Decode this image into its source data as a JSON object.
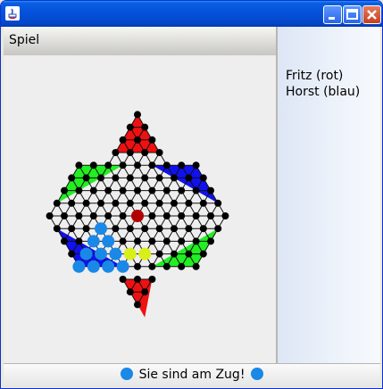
{
  "window": {
    "title": ""
  },
  "menu": {
    "items": [
      "Spiel"
    ]
  },
  "players": [
    {
      "label": "Fritz (rot)"
    },
    {
      "label": "Horst (blau)"
    }
  ],
  "status": {
    "text": "Sie sind am Zug!"
  },
  "colors": {
    "red_triangle": "#ee1111",
    "green_triangle": "#22ee22",
    "blue_triangle": "#1111ee",
    "red_piece": "#b00000",
    "blue_piece": "#1a88e6",
    "highlight": "#d8ef1a",
    "hole": "#000000",
    "board_bg": "#eeeeee"
  },
  "board": {
    "type": "star-halma",
    "red_pieces": [
      [
        0,
        4
      ],
      [
        1,
        4
      ],
      [
        1,
        5
      ],
      [
        2,
        4
      ],
      [
        2,
        5
      ],
      [
        2,
        6
      ],
      [
        3,
        4
      ],
      [
        3,
        5
      ],
      [
        3,
        6
      ],
      [
        3,
        7
      ],
      [
        8,
        6
      ]
    ],
    "blue_pieces": [
      [
        9,
        3
      ],
      [
        10,
        2
      ],
      [
        10,
        3
      ],
      [
        11,
        1
      ],
      [
        11,
        2
      ],
      [
        11,
        3
      ],
      [
        12,
        0
      ],
      [
        12,
        1
      ],
      [
        12,
        2
      ],
      [
        12,
        3
      ],
      [
        11,
        4
      ]
    ],
    "highlights": [
      [
        11,
        4
      ],
      [
        11,
        5
      ]
    ]
  }
}
